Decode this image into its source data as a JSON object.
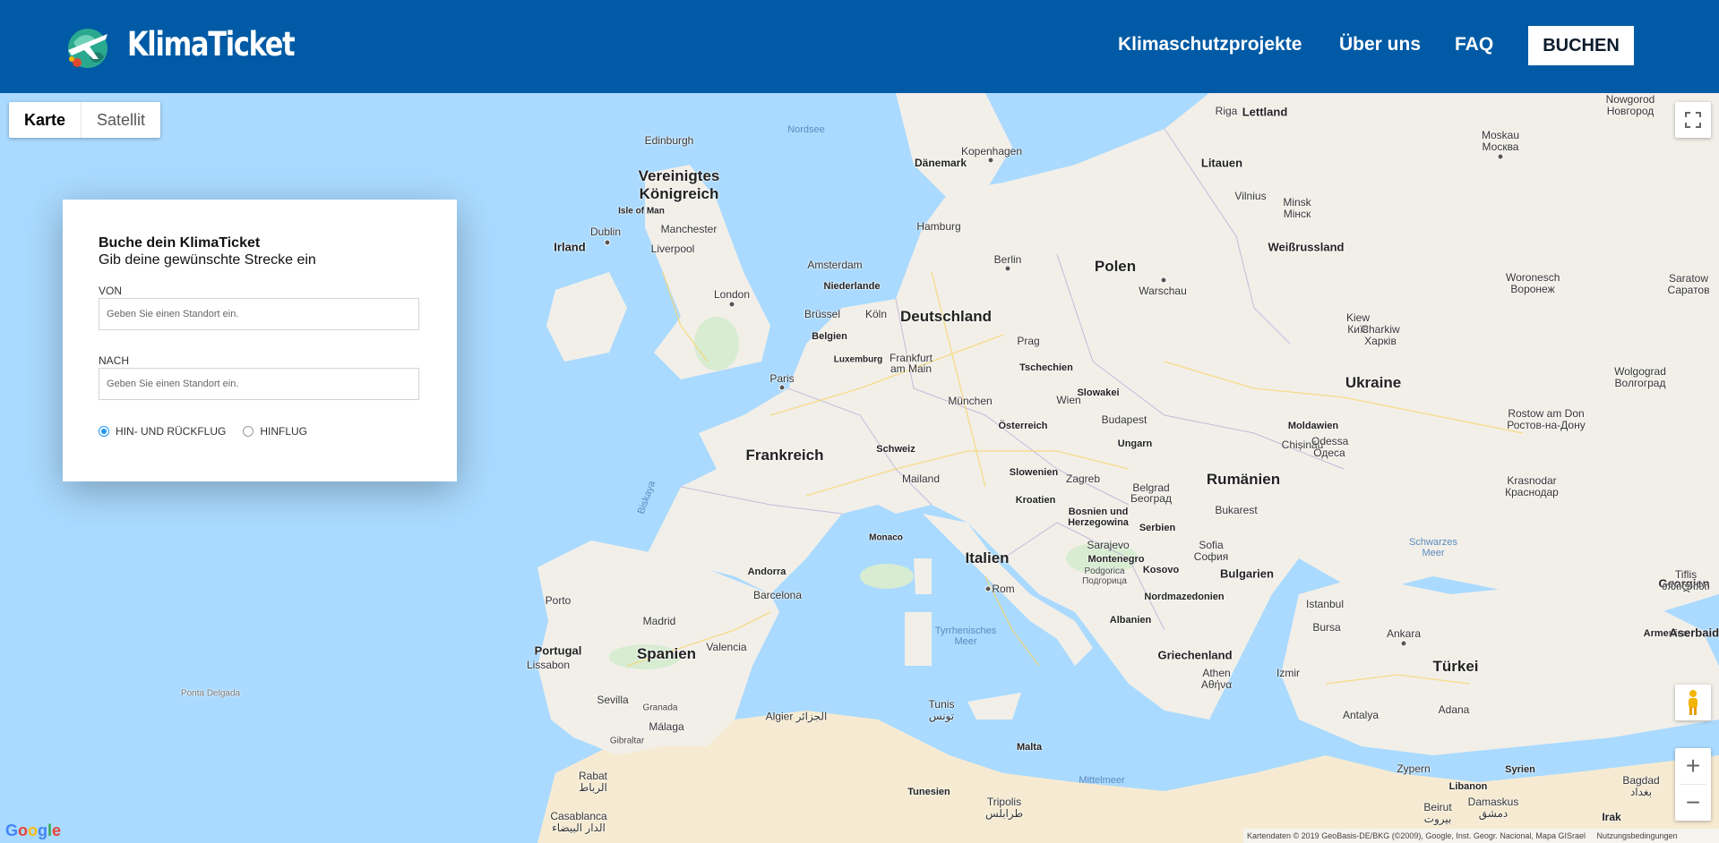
{
  "header": {
    "brand": "KlimaTicket",
    "nav": [
      "Klimaschutzprojekte",
      "Über uns",
      "FAQ"
    ],
    "cta": "BUCHEN"
  },
  "map_type": {
    "map": "Karte",
    "satellite": "Satellit"
  },
  "booking": {
    "title": "Buche dein KlimaTicket",
    "subtitle": "Gib deine gewünschte Strecke ein",
    "from_label": "VON",
    "from_placeholder": "Geben Sie einen Standort ein.",
    "to_label": "NACH",
    "to_placeholder": "Geben Sie einen Standort ein.",
    "trip_options": [
      {
        "label": "HIN- UND RÜCKFLUG",
        "selected": true
      },
      {
        "label": "HINFLUG",
        "selected": false
      }
    ]
  },
  "map": {
    "countries": [
      "Vereinigtes Königreich",
      "Irland",
      "Dänemark",
      "Deutschland",
      "Polen",
      "Litauen",
      "Weißrussland",
      "Ukraine",
      "Niederlande",
      "Belgien",
      "Luxemburg",
      "Frankreich",
      "Schweiz",
      "Tschechien",
      "Österreich",
      "Slowakei",
      "Ungarn",
      "Slowenien",
      "Kroatien",
      "Bosnien und Herzegowina",
      "Serbien",
      "Rumänien",
      "Moldawien",
      "Montenegro",
      "Kosovo",
      "Bulgarien",
      "Nordmazedonien",
      "Albanien",
      "Griechenland",
      "Italien",
      "Spanien",
      "Portugal",
      "Andorra",
      "Monaco",
      "Türkei",
      "Georgien",
      "Armenien",
      "Aserbaidschan",
      "Syrien",
      "Libanon",
      "Irak",
      "Tunesien",
      "Malta",
      "Isle of Man",
      "Lettland"
    ],
    "cities": [
      "Edinburgh",
      "Manchester",
      "Liverpool",
      "Dublin",
      "London",
      "Amsterdam",
      "Brüssel",
      "Köln",
      "Frankfurt am Main",
      "Hamburg",
      "Berlin",
      "Kopenhagen",
      "Riga",
      "Vilnius",
      "Minsk Мінск",
      "Warschau",
      "Prag",
      "München",
      "Wien",
      "Budapest",
      "Paris",
      "Mailand",
      "Zagreb",
      "Belgrad Београд",
      "Sarajevo",
      "Podgorica Подгорица",
      "Sofia София",
      "Bukarest",
      "Chișinău",
      "Odessa Одеса",
      "Kiew Київ",
      "Charkiw Харків",
      "Moskau Москва",
      "Nowgorod Новгород",
      "Woronesch Воронеж",
      "Saratow Саратов",
      "Wolgograd Волгоград",
      "Rostow am Don Ростов-на-Дону",
      "Krasnodar Краснодар",
      "Tiflis თბილისი",
      "Istanbul",
      "Bursa",
      "Ankara",
      "Izmir",
      "Antalya",
      "Adana",
      "Athen Αθήνα",
      "Rom",
      "Barcelona",
      "Madrid",
      "Valencia",
      "Porto",
      "Lissabon",
      "Sevilla",
      "Granada",
      "Málaga",
      "Gibraltar",
      "Rabat الرباط",
      "Casablanca الدار البيضاء",
      "Algier الجزائر",
      "Tunis تونس",
      "Tripolis طرابلس",
      "Zypern",
      "Beirut بيروت",
      "Damaskus دمشق",
      "Bagdad بغداد",
      "Ponta Delgada"
    ],
    "seas": [
      "Nordsee",
      "Biskaya",
      "Tyrrhenisches Meer",
      "Mittelmeer",
      "Schwarzes Meer"
    ]
  },
  "attribution": {
    "google": "Google",
    "data": "Kartendaten © 2019 GeoBasis-DE/BKG (©2009), Google, Inst. Geogr. Nacional, Mapa GISrael",
    "terms": "Nutzungsbedingungen"
  },
  "icons": [
    "klimaticket-logo-icon",
    "fullscreen-icon",
    "pegman-icon",
    "zoom-in-icon",
    "zoom-out-icon"
  ],
  "colors": {
    "header": "#005aa5",
    "water": "#aadaff",
    "land": "#f2efe9",
    "desert": "#f8ecd2",
    "accent": "#2196f3"
  }
}
